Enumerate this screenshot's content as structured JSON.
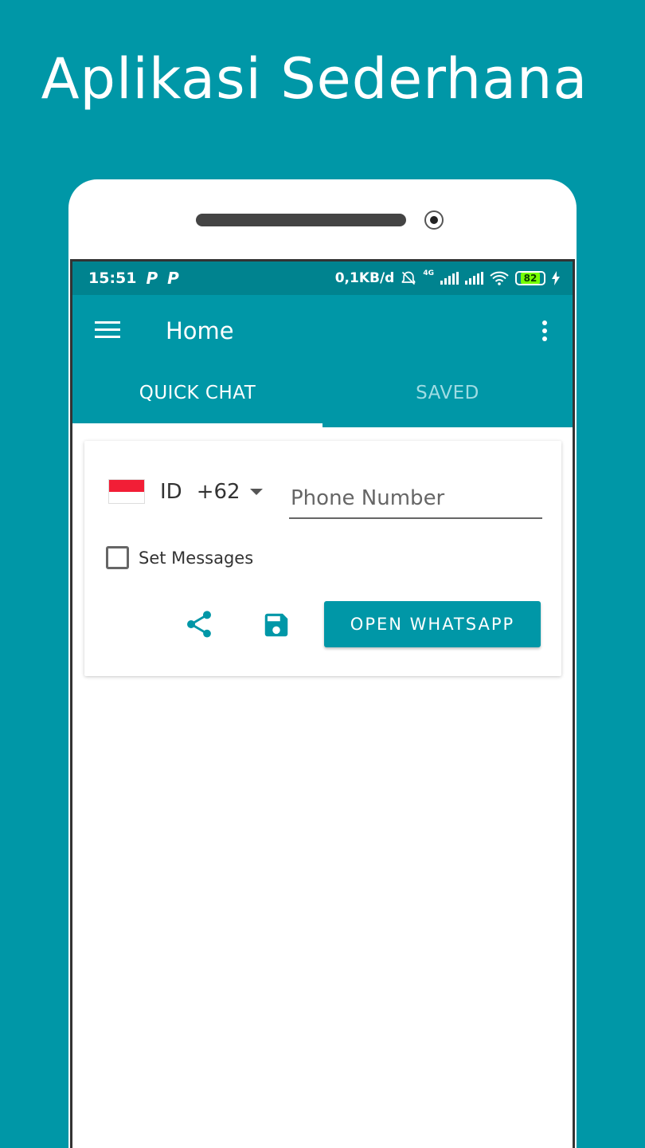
{
  "headline": "Aplikasi Sederhana",
  "status_bar": {
    "time": "15:51",
    "left_icons": [
      "P",
      "P"
    ],
    "data_usage": "0,1KB/d",
    "network_label": "4G",
    "battery": "82"
  },
  "appbar": {
    "title": "Home",
    "menu_icon": "hamburger-menu-icon",
    "overflow_icon": "more-vert-icon"
  },
  "tabs": [
    {
      "label": "QUICK CHAT",
      "active": true
    },
    {
      "label": "SAVED",
      "active": false
    }
  ],
  "form": {
    "country_code": "ID",
    "dial_code": "+62",
    "phone_placeholder": "Phone Number",
    "phone_value": "",
    "set_messages_label": "Set Messages",
    "set_messages_checked": false,
    "open_button_label": "OPEN WHATSAPP"
  },
  "colors": {
    "accent": "#0097a7",
    "status_bar": "#00838f",
    "flag_red": "#f21e36"
  }
}
